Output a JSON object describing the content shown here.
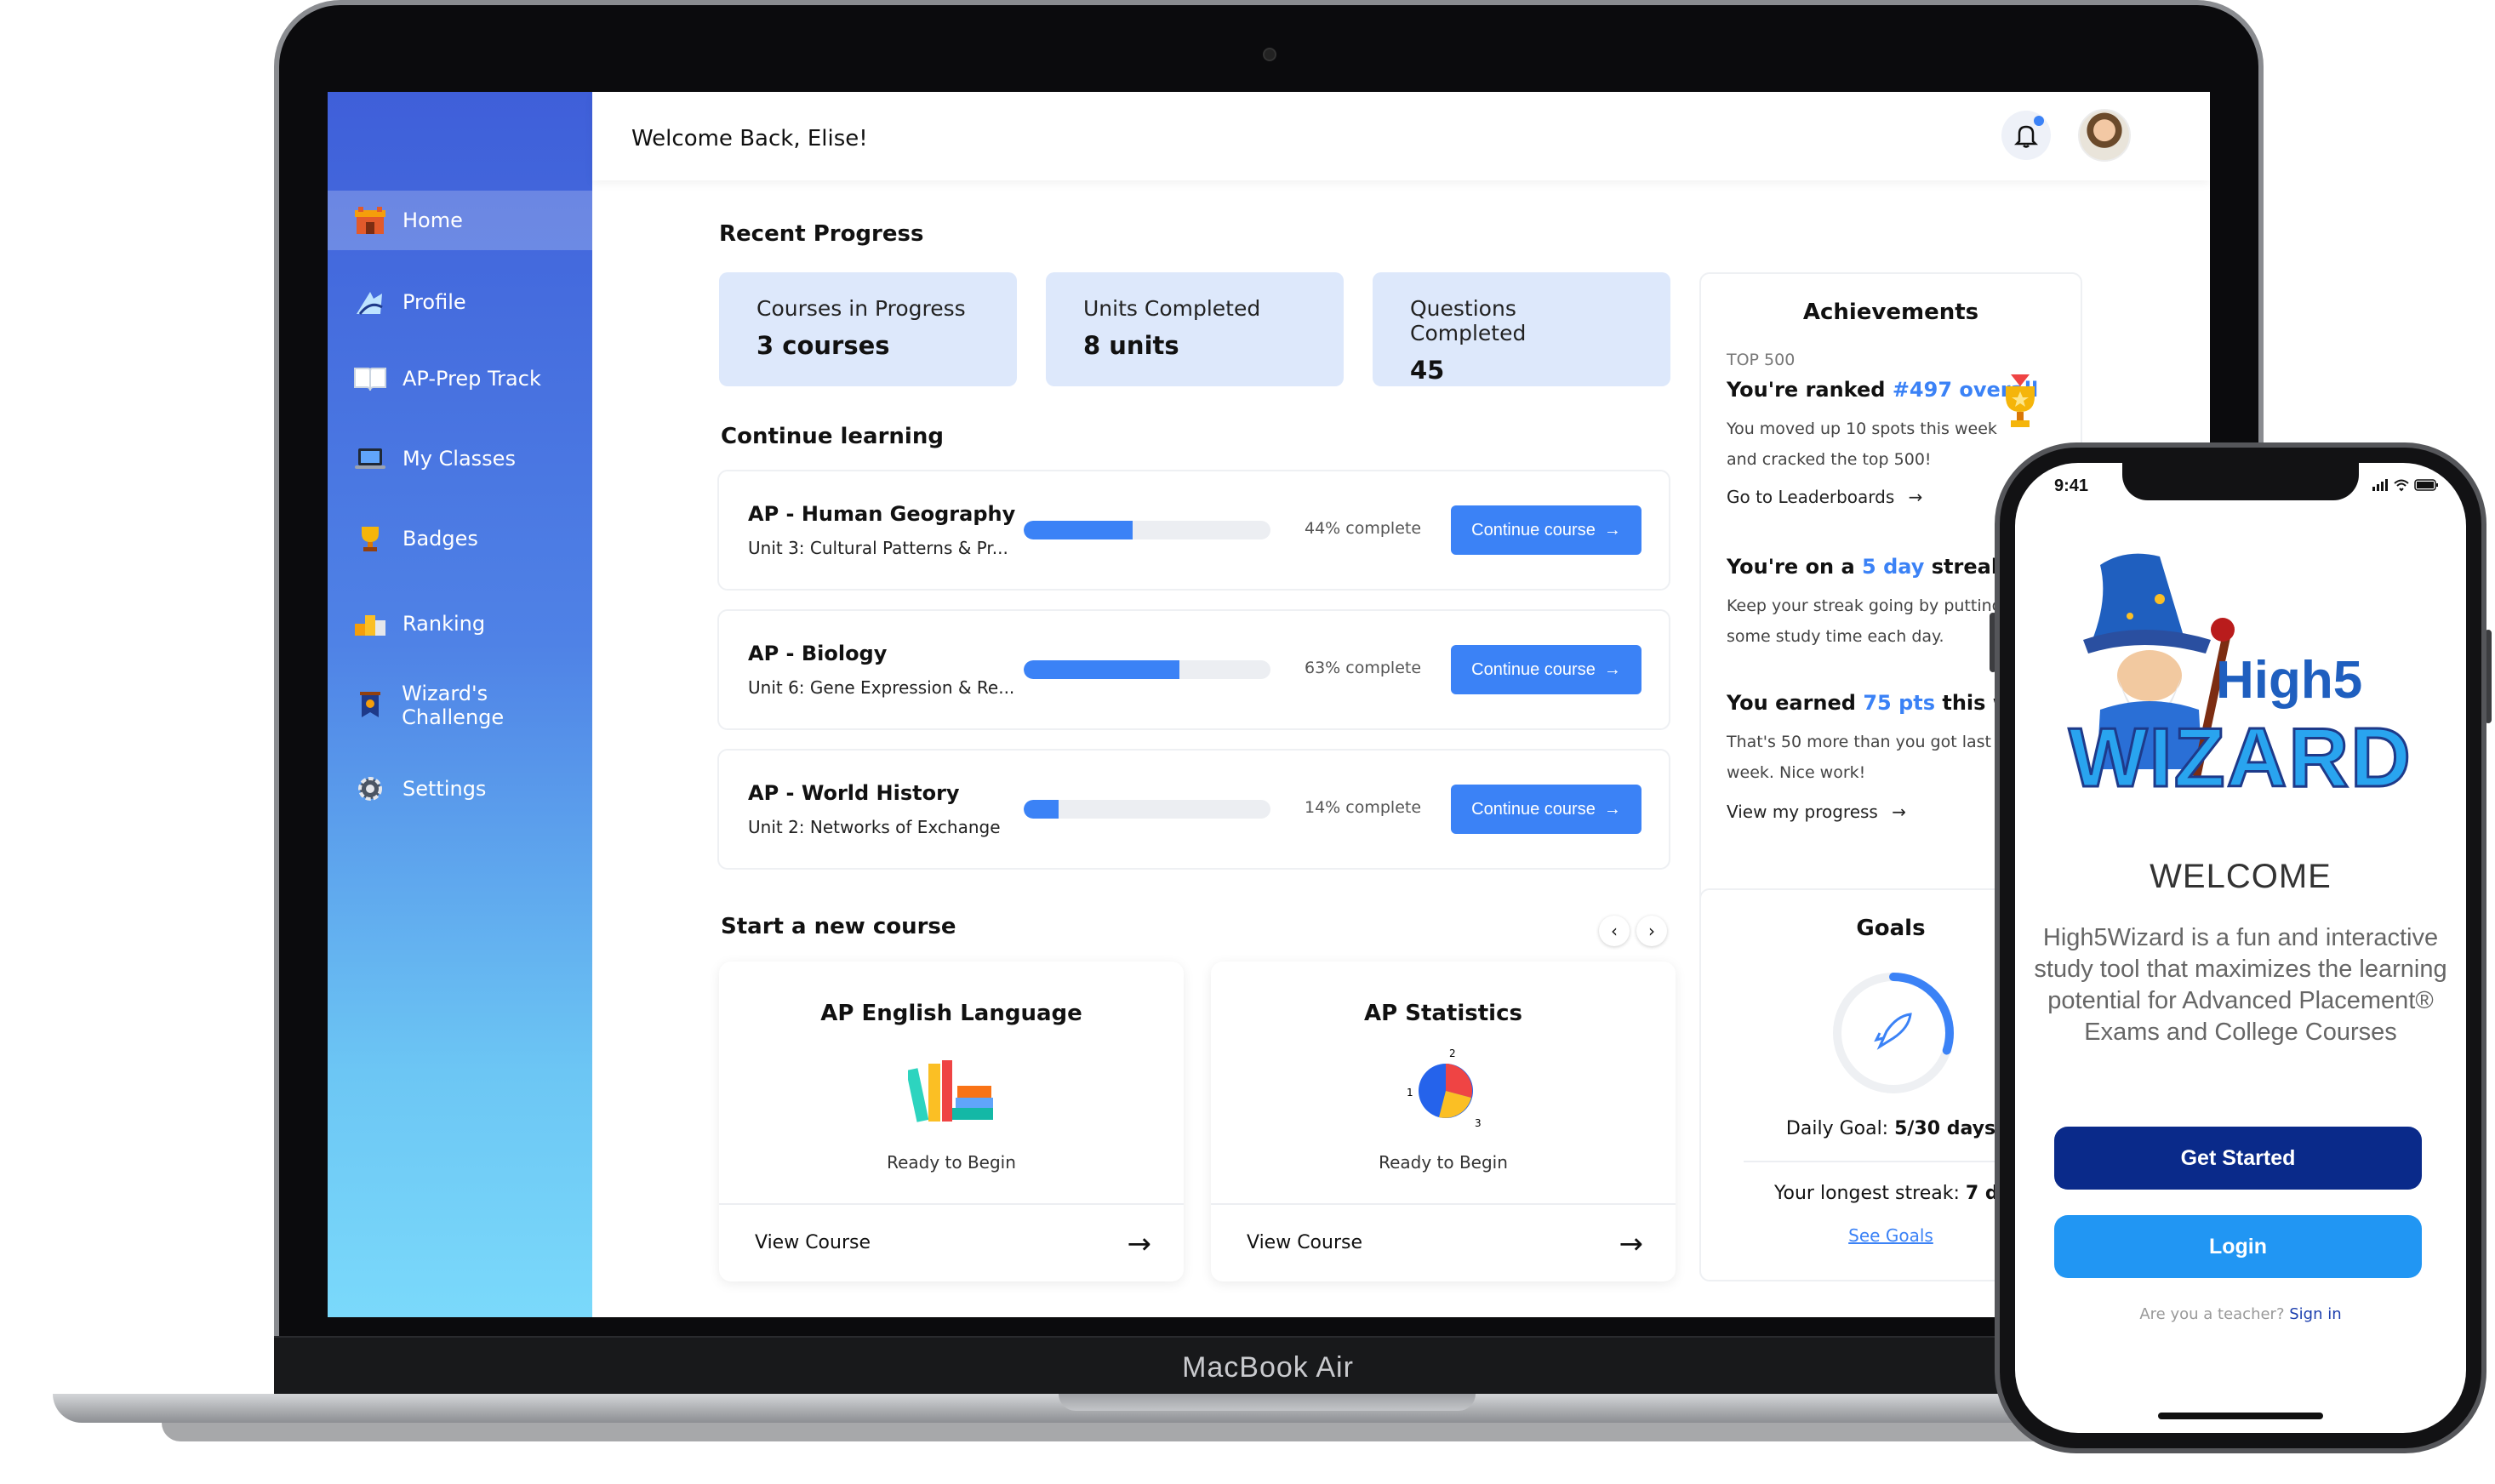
{
  "laptop": {
    "brand": "MacBook Air"
  },
  "sidebar": {
    "items": [
      {
        "label": "Home",
        "icon": "home-icon",
        "active": true
      },
      {
        "label": "Profile",
        "icon": "profile-icon",
        "active": false
      },
      {
        "label": "AP-Prep Track",
        "icon": "book-icon",
        "active": false
      },
      {
        "label": "My Classes",
        "icon": "laptop-icon",
        "active": false
      },
      {
        "label": "Badges",
        "icon": "trophy-icon",
        "active": false
      },
      {
        "label": "Ranking",
        "icon": "podium-icon",
        "active": false
      },
      {
        "label": "Wizard's Challenge",
        "icon": "banner-icon",
        "active": false
      },
      {
        "label": "Settings",
        "icon": "gear-icon",
        "active": false
      }
    ]
  },
  "header": {
    "welcome": "Welcome Back, Elise!",
    "bell_icon": "bell-icon",
    "has_notification": true
  },
  "recent_progress": {
    "title": "Recent Progress",
    "cards": [
      {
        "label": "Courses in Progress",
        "value": "3 courses"
      },
      {
        "label": "Units Completed",
        "value": "8 units"
      },
      {
        "label": "Questions Completed",
        "value": "45"
      }
    ]
  },
  "continue_learning": {
    "title": "Continue learning",
    "button_label": "Continue course",
    "courses": [
      {
        "title": "AP - Human Geography",
        "unit": "Unit 3: Cultural Patterns & Pr...",
        "progress": 0.44,
        "progress_text": "44% complete"
      },
      {
        "title": "AP - Biology",
        "unit": "Unit 6: Gene Expression & Re...",
        "progress": 0.63,
        "progress_text": "63% complete"
      },
      {
        "title": "AP - World History",
        "unit": "Unit 2: Networks of Exchange",
        "progress": 0.14,
        "progress_text": "14% complete"
      }
    ]
  },
  "new_course": {
    "title": "Start a new course",
    "prev_label": "‹",
    "next_label": "›",
    "courses": [
      {
        "title": "AP English Language",
        "status": "Ready to Begin",
        "link": "View Course",
        "icon": "books-icon"
      },
      {
        "title": "AP Statistics",
        "status": "Ready to Begin",
        "link": "View Course",
        "icon": "pie-chart-icon"
      }
    ],
    "arrow": "→"
  },
  "achievements": {
    "title": "Achievements",
    "tag": "TOP 500",
    "rank_prefix": "You're ranked ",
    "rank_value": "#497 overall",
    "rank_desc": "You moved up 10 spots this week and cracked the top 500!",
    "leaderboard_link": "Go to Leaderboards",
    "streak_prefix": "You're on a ",
    "streak_value": "5 day",
    "streak_suffix": " streak",
    "streak_desc": "Keep your streak going by putting in some study time each day.",
    "points_prefix": "You earned ",
    "points_value": "75 pts",
    "points_suffix": " this week",
    "points_desc": "That's 50 more than you got last week. Nice work!",
    "progress_link": "View my progress",
    "arrow": "→"
  },
  "goals": {
    "title": "Goals",
    "daily_label": "Daily Goal: ",
    "daily_value": "5/30 days",
    "daily_fraction": 0.1667,
    "streak_label": "Your longest streak: ",
    "streak_value": "7 days",
    "link": "See Goals"
  },
  "phone": {
    "time": "9:41",
    "logo_top": "High5",
    "logo_bottom": "WIZARD",
    "welcome": "WELCOME",
    "description": "High5Wizard is a fun and interactive study tool that maximizes the learning potential for Advanced Placement® Exams and College Courses",
    "get_started": "Get Started",
    "login": "Login",
    "teacher_prompt": "Are you a teacher? ",
    "sign_in": "Sign in"
  },
  "colors": {
    "accent": "#3b82f6",
    "stat_card_bg": "#dde8fb",
    "phone_primary": "#0a2a8a",
    "phone_secondary": "#2196f3"
  }
}
